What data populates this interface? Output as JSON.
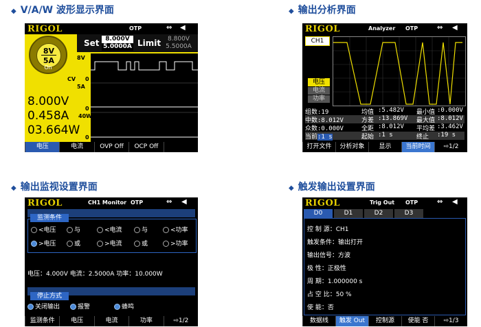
{
  "captions": {
    "s1": "V/A/W 波形显示界面",
    "s2": "输出分析界面",
    "s3": "输出监视设置界面",
    "s4": "触发输出设置界面"
  },
  "common": {
    "logo": "RIGOL",
    "otp": "OTP",
    "usb": "⇔",
    "speaker": "◀"
  },
  "s1": {
    "knob_v": "8V",
    "knob_a": "5A",
    "knob_on": "On",
    "set_label": "Set",
    "set_v": "8.000V",
    "set_a": "5.0000A",
    "limit_label": "Limit",
    "limit_v": "8.800V",
    "limit_a": "5.5000A",
    "volt": "8.000V",
    "curr": "0.458A",
    "power": "03.664W",
    "cv": "CV",
    "scale_v": "8V",
    "scale_a": "5A",
    "scale_w": "40W",
    "zero": "0",
    "softkeys": [
      "电压",
      "电流",
      "OVP  Off",
      "OCP  Off",
      ""
    ]
  },
  "s2": {
    "title": "Analyzer",
    "ch": "CH1",
    "opt1": "电压",
    "opt2": "电流",
    "opt3": "功率",
    "rows": [
      [
        "组数",
        ":19",
        "均值",
        ":5.482V",
        "最小值",
        ":0.000V"
      ],
      [
        "中数",
        ":8.012V",
        "方差",
        ":13.869V",
        "最大值",
        ":8.012V"
      ],
      [
        "众数",
        ":0.000V",
        "全距",
        ":8.012V",
        "平均差",
        ":3.462V"
      ],
      [
        "当前",
        ":1 s",
        "起始",
        ":1 s",
        "终止",
        ":19 s"
      ]
    ],
    "softkeys": [
      "打开文件",
      "分析对象",
      "显示",
      "当前时间",
      "⇨1/2"
    ]
  },
  "s3": {
    "title": "CH1 Monitor",
    "cond_header": "监测条件",
    "opts": [
      [
        "<电压",
        "与",
        "<电流",
        "与",
        "<功率"
      ],
      [
        ">电压",
        "或",
        ">电流",
        "或",
        ">功率"
      ]
    ],
    "vals": "电压：4.000V    电流：2.5000A    功率：10.000W",
    "stop_header": "停止方式",
    "stop1": "关闭输出",
    "stop2": "报警",
    "stop3": "蜂鸣",
    "softkeys": [
      "监测条件",
      "电压",
      "电流",
      "功率",
      "⇨1/2"
    ]
  },
  "s4": {
    "title": "Trig Out",
    "tabs": [
      "D0",
      "D1",
      "D2",
      "D3"
    ],
    "rows": [
      "控 制 源：CH1",
      "触发条件：输出打开",
      "输出信号：方波",
      "极     性：正极性",
      "周     期：1.000000 s",
      "占 空 比：50 %",
      "使     能：否"
    ],
    "softkeys": [
      "数据线",
      "触发 Out",
      "控制源",
      "使能  否",
      "⇨1/3"
    ]
  }
}
